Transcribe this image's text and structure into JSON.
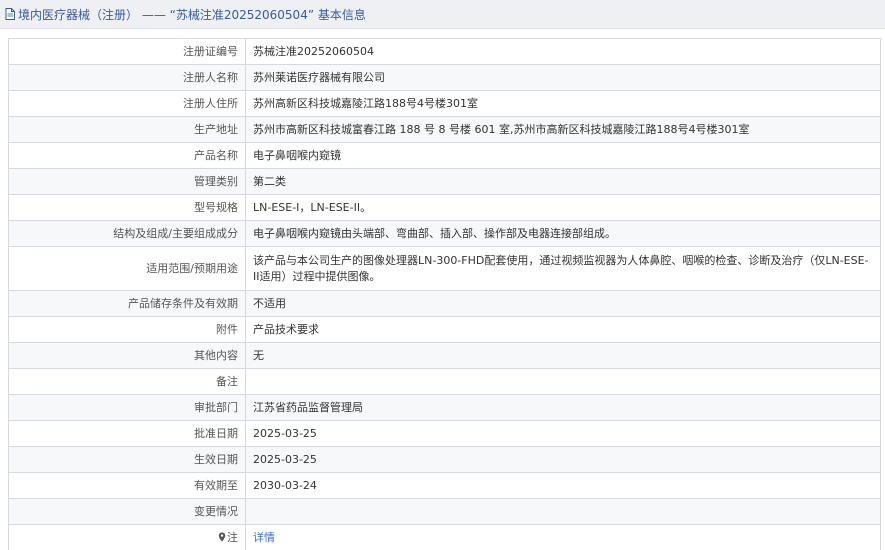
{
  "header": {
    "title": "境内医疗器械（注册） ——  “苏械注准20252060504” 基本信息",
    "icon": "document-icon"
  },
  "rows": [
    {
      "label": "注册证编号",
      "value": "苏械注准20252060504"
    },
    {
      "label": "注册人名称",
      "value": "苏州莱诺医疗器械有限公司"
    },
    {
      "label": "注册人住所",
      "value": "苏州高新区科技城嘉陵江路188号4号楼301室"
    },
    {
      "label": "生产地址",
      "value": "苏州市高新区科技城富春江路 188 号 8 号楼 601 室,苏州市高新区科技城嘉陵江路188号4号楼301室"
    },
    {
      "label": "产品名称",
      "value": "电子鼻咽喉内窥镜"
    },
    {
      "label": "管理类别",
      "value": "第二类"
    },
    {
      "label": "型号规格",
      "value": "LN-ESE-I，LN-ESE-II。"
    },
    {
      "label": "结构及组成/主要组成成分",
      "value": "电子鼻咽喉内窥镜由头端部、弯曲部、插入部、操作部及电器连接部组成。"
    },
    {
      "label": "适用范围/预期用途",
      "value": "该产品与本公司生产的图像处理器LN-300-FHD配套使用，通过视频监视器为人体鼻腔、咽喉的检查、诊断及治疗（仅LN-ESE-II适用）过程中提供图像。"
    },
    {
      "label": "产品储存条件及有效期",
      "value": "不适用"
    },
    {
      "label": "附件",
      "value": "产品技术要求"
    },
    {
      "label": "其他内容",
      "value": "无"
    },
    {
      "label": "备注",
      "value": ""
    },
    {
      "label": "审批部门",
      "value": "江苏省药品监督管理局"
    },
    {
      "label": "批准日期",
      "value": "2025-03-25"
    },
    {
      "label": "生效日期",
      "value": "2025-03-25"
    },
    {
      "label": "有效期至",
      "value": "2030-03-24"
    },
    {
      "label": "变更情况",
      "value": ""
    }
  ],
  "note_row": {
    "label": "注",
    "icon": "location-pin-icon",
    "link_text": "详情"
  }
}
